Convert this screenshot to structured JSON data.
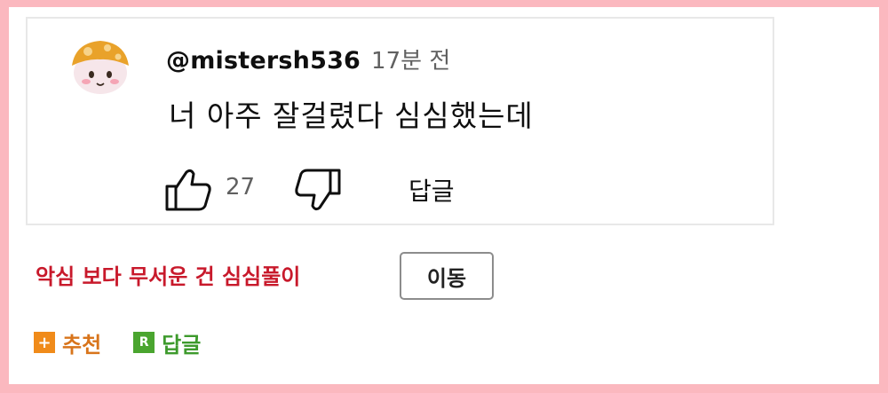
{
  "comment": {
    "handle": "@mistersh536",
    "time": "17분 전",
    "text": "너 아주 잘걸렸다 심심했는데",
    "like_count": "27",
    "reply_label": "답글",
    "avatar_icon": "mushroom-avatar-icon",
    "like_icon": "thumbs-up-icon",
    "dislike_icon": "thumbs-down-icon"
  },
  "caption": {
    "text": "악심 보다 무서운 건 심심풀이",
    "color": "#c8192b"
  },
  "move_button": {
    "label": "이동"
  },
  "bottom_bar": {
    "recommend": {
      "icon_text": "+",
      "label": "추천",
      "color": "#d8741b"
    },
    "reply": {
      "icon_text": "R",
      "label": "답글",
      "color": "#3d9a2c"
    }
  },
  "frame_color": "#fbb8bf"
}
